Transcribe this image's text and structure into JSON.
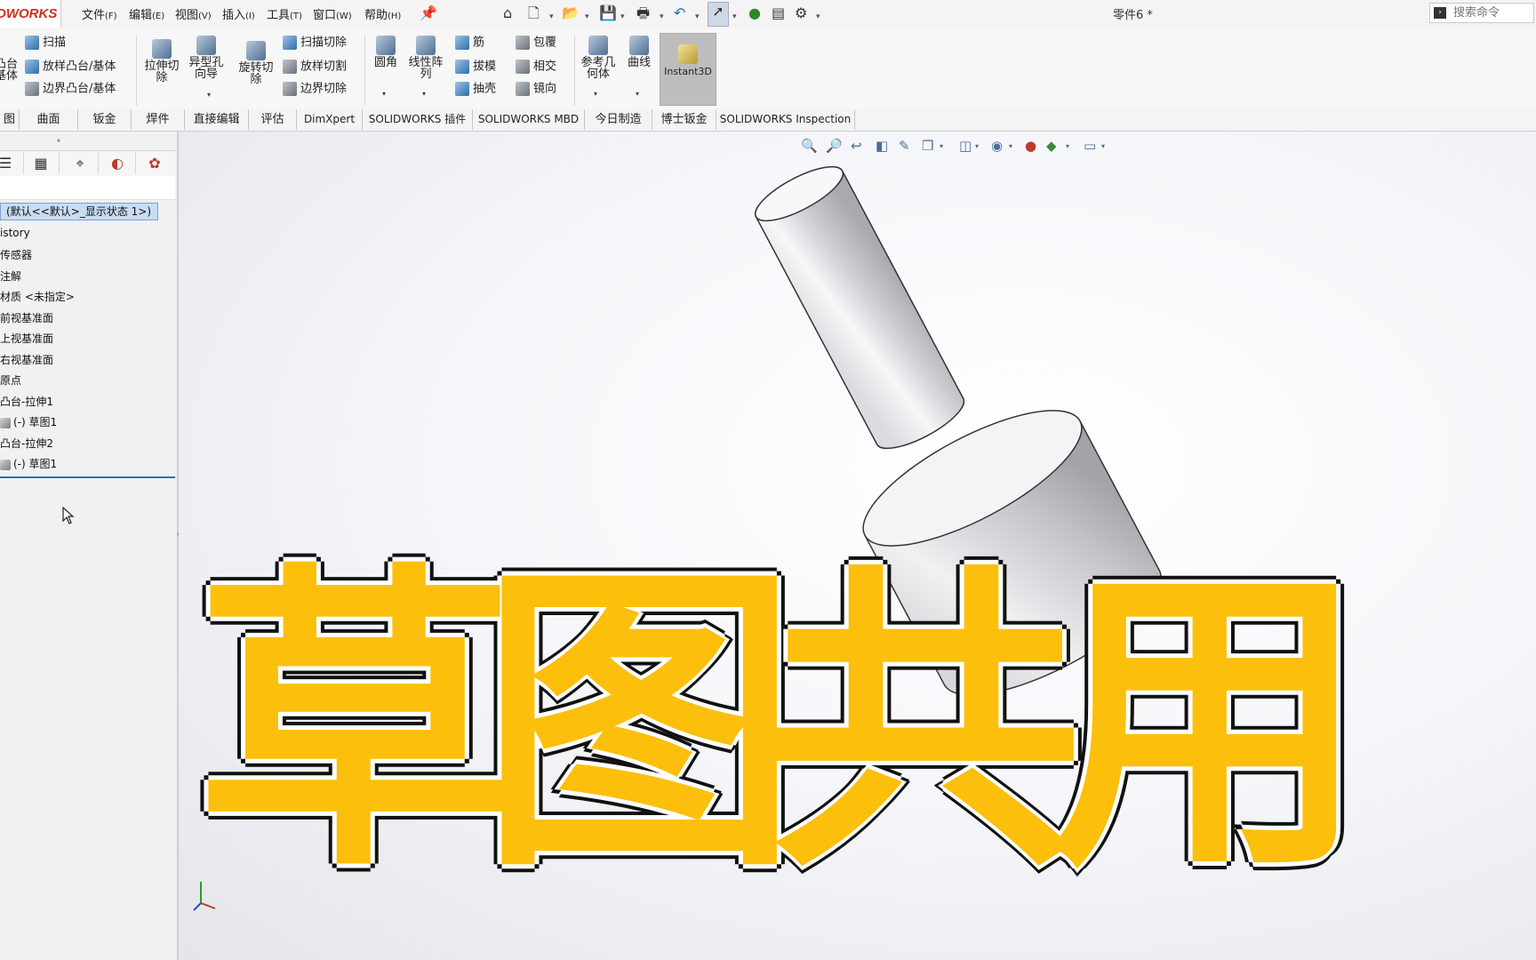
{
  "app": {
    "logo_text": "DWORKS",
    "document_title": "零件6 *"
  },
  "menu": {
    "items": [
      {
        "label": "文件",
        "key": "(F)"
      },
      {
        "label": "编辑",
        "key": "(E)"
      },
      {
        "label": "视图",
        "key": "(V)"
      },
      {
        "label": "插入",
        "key": "(I)"
      },
      {
        "label": "工具",
        "key": "(T)"
      },
      {
        "label": "窗口",
        "key": "(W)"
      },
      {
        "label": "帮助",
        "key": "(H)"
      }
    ]
  },
  "search": {
    "placeholder": "搜索命令"
  },
  "ribbon": {
    "sweep": "扫描",
    "loft_boss": "放样凸台/基体",
    "boundary_boss": "边界凸台/基体",
    "boss_partial_1": "凸台",
    "boss_partial_2": "基体",
    "extruded_cut_1": "拉伸切",
    "extruded_cut_2": "除",
    "hole_wizard_1": "异型孔",
    "hole_wizard_2": "向导",
    "revolved_cut_1": "旋转切",
    "revolved_cut_2": "除",
    "swept_cut": "扫描切除",
    "lofted_cut": "放样切割",
    "boundary_cut": "边界切除",
    "fillet": "圆角",
    "linear_pattern_1": "线性阵",
    "linear_pattern_2": "列",
    "rib": "筋",
    "draft": "拔模",
    "shell": "抽壳",
    "wrap": "包覆",
    "intersect": "相交",
    "mirror": "镜向",
    "ref_geometry_1": "参考几",
    "ref_geometry_2": "何体",
    "curves": "曲线",
    "instant3d": "Instant3D"
  },
  "tabs": [
    "图",
    "曲面",
    "钣金",
    "焊件",
    "直接编辑",
    "评估",
    "DimXpert",
    "SOLIDWORKS 插件",
    "SOLIDWORKS MBD",
    "今日制造",
    "博士钣金",
    "SOLIDWORKS Inspection"
  ],
  "tree": {
    "config": "(默认<<默认>_显示状态 1>)",
    "items": [
      "istory",
      "传感器",
      "注解",
      "材质 <未指定>",
      "前视基准面",
      "上视基准面",
      "右视基准面",
      "原点",
      "凸台-拉伸1",
      "(-) 草图1",
      "凸台-拉伸2",
      "(-) 草图1"
    ]
  },
  "overlay": {
    "title": "草图共用"
  },
  "colors": {
    "overlay_fill": "#fcbf0c",
    "overlay_outline": "#0c0c0c",
    "logo_red": "#d52b1e",
    "selection_blue": "#c9dcf2",
    "rollback_bar": "#2a6fc2"
  },
  "icons": [
    "home-icon",
    "new-document-icon",
    "open-folder-icon",
    "save-icon",
    "print-icon",
    "undo-icon",
    "select-cursor-icon",
    "traffic-light-icon",
    "file-properties-icon",
    "options-gear-icon",
    "zoom-to-fit-icon",
    "zoom-area-icon",
    "previous-view-icon",
    "section-view-icon",
    "dynamic-annotation-icon",
    "view-orientation-icon",
    "display-style-icon",
    "hide-show-icon",
    "edit-appearance-icon",
    "apply-scene-icon",
    "view-settings-icon",
    "cylinder-part-model",
    "coordinate-triad-icon"
  ]
}
